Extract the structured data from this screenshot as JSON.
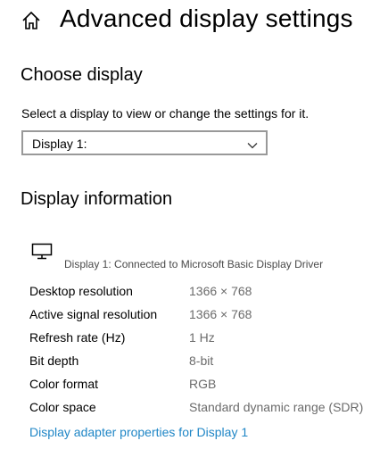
{
  "header": {
    "title": "Advanced display settings",
    "home_icon": "home-icon"
  },
  "choose_display": {
    "heading": "Choose display",
    "instruction": "Select a display to view or change the settings for it.",
    "dropdown": {
      "selected": "Display 1:",
      "icon": "chevron-down-icon"
    }
  },
  "display_info": {
    "heading": "Display information",
    "monitor_icon": "monitor-icon",
    "connection": "Display 1: Connected to Microsoft Basic Display Driver",
    "rows": [
      {
        "label": "Desktop resolution",
        "value": "1366 × 768"
      },
      {
        "label": "Active signal resolution",
        "value": "1366 × 768"
      },
      {
        "label": "Refresh rate (Hz)",
        "value": "1 Hz"
      },
      {
        "label": "Bit depth",
        "value": "8-bit"
      },
      {
        "label": "Color format",
        "value": "RGB"
      },
      {
        "label": "Color space",
        "value": "Standard dynamic range (SDR)"
      }
    ],
    "adapter_link": "Display adapter properties for Display 1"
  },
  "colors": {
    "link": "#1f86c6",
    "value_text": "#6b6b6b",
    "dropdown_border": "#999999"
  }
}
